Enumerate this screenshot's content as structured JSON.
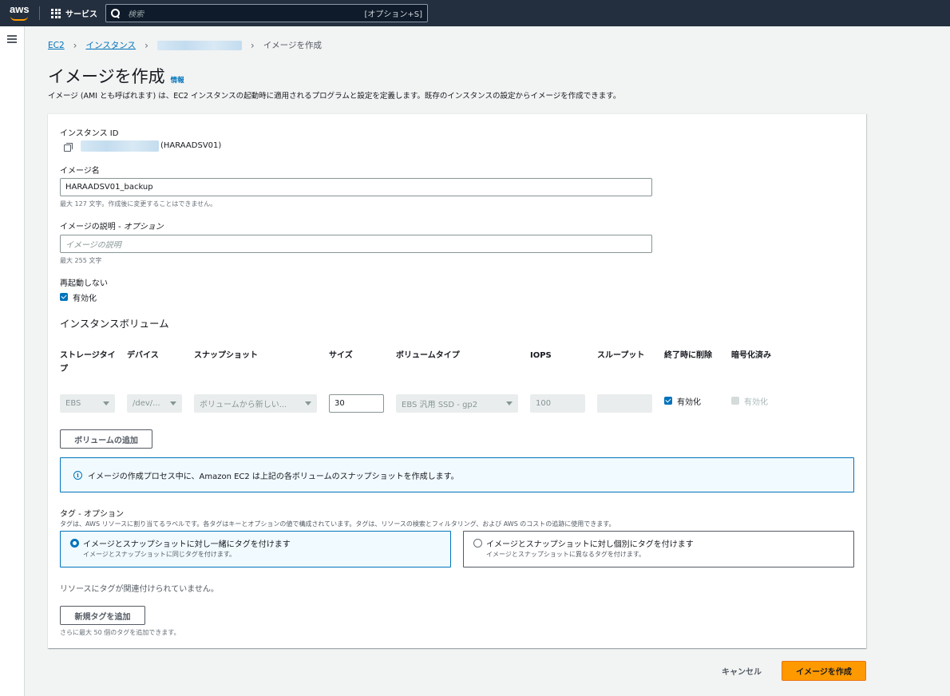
{
  "header": {
    "logo_text": "aws",
    "services_label": "サービス",
    "search_placeholder": "検索",
    "search_shortcut": "[オプション+S]"
  },
  "breadcrumb": {
    "items": [
      "EC2",
      "インスタンス"
    ],
    "current": "イメージを作成"
  },
  "page": {
    "title": "イメージを作成",
    "info_link": "情報",
    "description": "イメージ (AMI とも呼ばれます) は、EC2 インスタンスの起動時に適用されるプログラムと設定を定義します。既存のインスタンスの設定からイメージを作成できます。"
  },
  "form": {
    "instance_id_label": "インスタンス ID",
    "instance_name": "(HARAADSV01)",
    "image_name_label": "イメージ名",
    "image_name_value": "HARAADSV01_backup",
    "image_name_hint": "最大 127 文字。作成後に変更することはできません。",
    "image_desc_label": "イメージの説明 - ",
    "image_desc_optional": "オプション",
    "image_desc_placeholder": "イメージの説明",
    "image_desc_hint": "最大 255 文字",
    "no_reboot_label": "再起動しない",
    "no_reboot_value": "有効化"
  },
  "volumes": {
    "heading": "インスタンスボリューム",
    "columns": [
      "ストレージタイプ",
      "デバイス",
      "スナップショット",
      "サイズ",
      "ボリュームタイプ",
      "IOPS",
      "スループット",
      "終了時に削除",
      "暗号化済み"
    ],
    "row": {
      "storage_type": "EBS",
      "device": "/dev/...",
      "snapshot": "ボリュームから新しい...",
      "size": "30",
      "volume_type": "EBS 汎用 SSD - gp2",
      "iops": "100",
      "throughput": "",
      "delete_on_termination": "有効化",
      "encrypted": "有効化"
    },
    "add_button": "ボリュームの追加",
    "alert": "イメージの作成プロセス中に、Amazon EC2 は上記の各ボリュームのスナップショットを作成します。"
  },
  "tags": {
    "heading": "タグ - オプション",
    "description": "タグは、AWS リソースに割り当てるラベルです。各タグはキーとオプションの値で構成されています。タグは、リソースの検索とフィルタリング、および AWS のコストの追跡に使用できます。",
    "options": [
      {
        "title": "イメージとスナップショットに対し一緒にタグを付けます",
        "sub": "イメージとスナップショットに同じタグを付けます。",
        "selected": true
      },
      {
        "title": "イメージとスナップショットに対し個別にタグを付けます",
        "sub": "イメージとスナップショットに異なるタグを付けます。",
        "selected": false
      }
    ],
    "empty_text": "リソースにタグが関連付けられていません。",
    "add_button": "新規タグを追加",
    "add_hint": "さらに最大 50 個のタグを追加できます。"
  },
  "footer": {
    "cancel": "キャンセル",
    "submit": "イメージを作成"
  },
  "colors": {
    "nav_bg": "#232f3e",
    "link": "#0073bb",
    "primary": "#ff9900"
  }
}
